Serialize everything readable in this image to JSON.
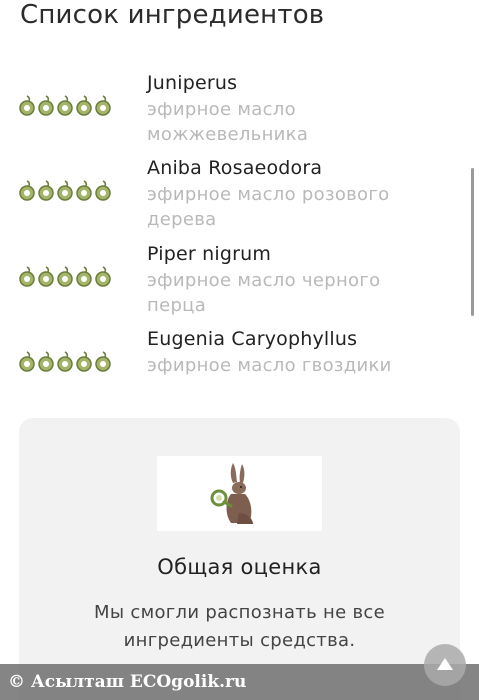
{
  "page": {
    "title": "Список ингредиентов"
  },
  "colors": {
    "olive_fill": "#a4b56a",
    "olive_ring": "#6b7d3a",
    "muted_text": "#b9b9b9"
  },
  "ingredients": [
    {
      "name": "Juniperus",
      "desc_line1": "эфирное масло",
      "desc_line2": "можжевельника",
      "rating": 5,
      "rating_icon": "olive-icon"
    },
    {
      "name": "Aniba Rosaeodora",
      "desc_line1": "эфирное масло розового",
      "desc_line2": "дерева",
      "rating": 5,
      "rating_icon": "olive-icon"
    },
    {
      "name": "Piper nigrum",
      "desc_line1": "эфирное масло черного",
      "desc_line2": "перца",
      "rating": 5,
      "rating_icon": "olive-icon"
    },
    {
      "name": "Eugenia Caryophyllus",
      "desc_line1": "эфирное масло гвоздики",
      "desc_line2": "",
      "rating": 5,
      "rating_icon": "olive-icon"
    }
  ],
  "summary_card": {
    "logo_icon": "rabbit-magnifier-icon",
    "title": "Общая оценка",
    "text": "Мы смогли распознать не все ингредиенты средства."
  },
  "footer": {
    "copyright": "© Асылташ ECOgolik.ru"
  },
  "scroll_top_icon": "arrow-up-icon"
}
